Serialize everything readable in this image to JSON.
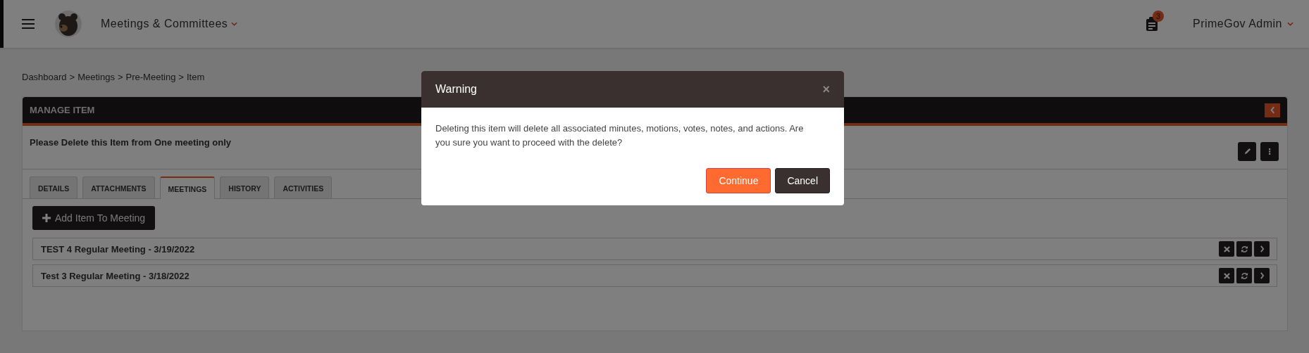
{
  "topbar": {
    "app_title": "Meetings & Committees",
    "notifications": "3",
    "user": "PrimeGov Admin"
  },
  "breadcrumb": {
    "separator": ">",
    "items": [
      "Dashboard",
      "Meetings",
      "Pre-Meeting",
      "Item"
    ]
  },
  "card": {
    "title": "MANAGE ITEM",
    "item_title": "Please Delete this Item from One meeting only",
    "tabs": [
      {
        "label": "DETAILS",
        "selected": false
      },
      {
        "label": "ATTACHMENTS",
        "selected": false
      },
      {
        "label": "MEETINGS",
        "selected": true
      },
      {
        "label": "HISTORY",
        "selected": false
      },
      {
        "label": "ACTIVITIES",
        "selected": false
      }
    ],
    "add_button": "Add Item To Meeting",
    "meetings": [
      "TEST 4 Regular Meeting - 3/19/2022",
      "Test 3 Regular Meeting - 3/18/2022"
    ]
  },
  "modal": {
    "title": "Warning",
    "close": "×",
    "message": "Deleting this item will delete all associated minutes, motions, votes, notes, and actions. Are you sure you want to proceed with the delete?",
    "buttons": [
      {
        "label": "Continue",
        "kind": "primary"
      },
      {
        "label": "Cancel",
        "kind": "secondary"
      }
    ]
  }
}
